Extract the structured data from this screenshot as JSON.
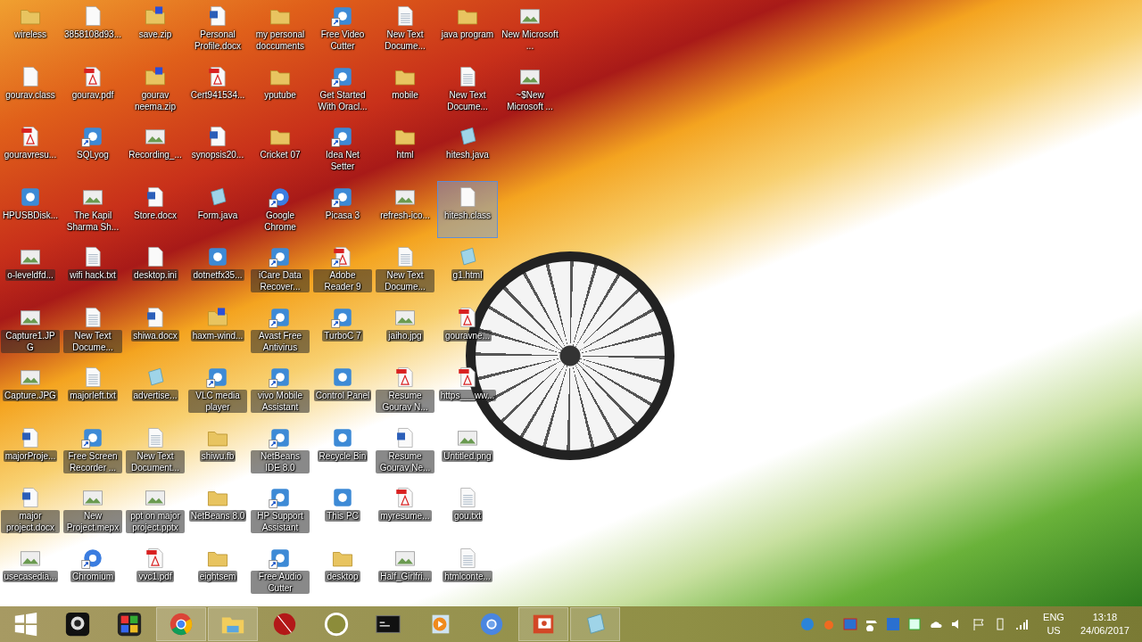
{
  "desktop_icon_rows": [
    [
      {
        "label": "wireless",
        "kind": "folder",
        "shortcut": false,
        "selected": false
      },
      {
        "label": "3858108d93...",
        "kind": "blank",
        "shortcut": false,
        "selected": false
      },
      {
        "label": "save.zip",
        "kind": "zip",
        "shortcut": false,
        "selected": false
      },
      {
        "label": "Personal Profile.docx",
        "kind": "word",
        "shortcut": false,
        "selected": false
      },
      {
        "label": "my personal doccuments",
        "kind": "folder",
        "shortcut": false,
        "selected": false
      },
      {
        "label": "Free Video Cutter",
        "kind": "app",
        "shortcut": true,
        "selected": false
      },
      {
        "label": "New Text Docume...",
        "kind": "text",
        "shortcut": false,
        "selected": false
      },
      {
        "label": "java program",
        "kind": "folder",
        "shortcut": false,
        "selected": false
      },
      {
        "label": "New Microsoft ...",
        "kind": "image",
        "shortcut": false,
        "selected": false
      }
    ],
    [
      {
        "label": "gourav.class",
        "kind": "blank",
        "shortcut": false,
        "selected": false
      },
      {
        "label": "gourav.pdf",
        "kind": "pdf",
        "shortcut": false,
        "selected": false
      },
      {
        "label": "gourav neema.zip",
        "kind": "zip",
        "shortcut": false,
        "selected": false
      },
      {
        "label": "Cert941534...",
        "kind": "pdf",
        "shortcut": false,
        "selected": false
      },
      {
        "label": "yputube",
        "kind": "folder",
        "shortcut": false,
        "selected": false
      },
      {
        "label": "Get Started With Oracl...",
        "kind": "app",
        "shortcut": true,
        "selected": false
      },
      {
        "label": "mobile",
        "kind": "folder",
        "shortcut": false,
        "selected": false
      },
      {
        "label": "New Text Docume...",
        "kind": "text",
        "shortcut": false,
        "selected": false
      },
      {
        "label": "~$New Microsoft ...",
        "kind": "image",
        "shortcut": false,
        "selected": false
      }
    ],
    [
      {
        "label": "gouravresu...",
        "kind": "pdf",
        "shortcut": false,
        "selected": false
      },
      {
        "label": "SQLyog",
        "kind": "app",
        "shortcut": true,
        "selected": false
      },
      {
        "label": "Recording_...",
        "kind": "image",
        "shortcut": false,
        "selected": false
      },
      {
        "label": "synopsis20...",
        "kind": "word",
        "shortcut": false,
        "selected": false
      },
      {
        "label": "Cricket 07",
        "kind": "folder",
        "shortcut": false,
        "selected": false
      },
      {
        "label": "Idea Net Setter",
        "kind": "app",
        "shortcut": true,
        "selected": false
      },
      {
        "label": "html",
        "kind": "folder",
        "shortcut": false,
        "selected": false
      },
      {
        "label": "hitesh.java",
        "kind": "notepad",
        "shortcut": false,
        "selected": false
      }
    ],
    [
      {
        "label": "HPUSBDisk...",
        "kind": "app",
        "shortcut": false,
        "selected": false
      },
      {
        "label": "The Kapil Sharma Sh...",
        "kind": "image",
        "shortcut": false,
        "selected": false
      },
      {
        "label": "Store.docx",
        "kind": "word",
        "shortcut": false,
        "selected": false
      },
      {
        "label": "Form.java",
        "kind": "notepad",
        "shortcut": false,
        "selected": false
      },
      {
        "label": "Google Chrome",
        "kind": "browser",
        "shortcut": true,
        "selected": false
      },
      {
        "label": "Picasa 3",
        "kind": "app",
        "shortcut": true,
        "selected": false
      },
      {
        "label": "refresh-ico...",
        "kind": "image",
        "shortcut": false,
        "selected": false
      },
      {
        "label": "hitesh.class",
        "kind": "blank",
        "shortcut": false,
        "selected": true
      }
    ],
    [
      {
        "label": "o-leveldfd...",
        "kind": "image",
        "shortcut": false,
        "selected": false
      },
      {
        "label": "wifi hack.txt",
        "kind": "text",
        "shortcut": false,
        "selected": false
      },
      {
        "label": "desktop.ini",
        "kind": "blank",
        "shortcut": false,
        "selected": false
      },
      {
        "label": "dotnetfx35...",
        "kind": "app",
        "shortcut": false,
        "selected": false
      },
      {
        "label": "iCare Data Recover...",
        "kind": "app",
        "shortcut": true,
        "selected": false
      },
      {
        "label": "Adobe Reader 9",
        "kind": "pdf",
        "shortcut": true,
        "selected": false
      },
      {
        "label": "New Text Docume...",
        "kind": "text",
        "shortcut": false,
        "selected": false
      },
      {
        "label": "g1.html",
        "kind": "notepad",
        "shortcut": false,
        "selected": false
      }
    ],
    [
      {
        "label": "Capture1.JPG",
        "kind": "image",
        "shortcut": false,
        "selected": false
      },
      {
        "label": "New Text Docume...",
        "kind": "text",
        "shortcut": false,
        "selected": false
      },
      {
        "label": "shiwa.docx",
        "kind": "word",
        "shortcut": false,
        "selected": false
      },
      {
        "label": "haxm-wind...",
        "kind": "zip",
        "shortcut": false,
        "selected": false
      },
      {
        "label": "Avast Free Antivirus",
        "kind": "app",
        "shortcut": true,
        "selected": false
      },
      {
        "label": "TurboC 7",
        "kind": "app",
        "shortcut": true,
        "selected": false
      },
      {
        "label": "jaiho.jpg",
        "kind": "image",
        "shortcut": false,
        "selected": false
      },
      {
        "label": "gouravne...",
        "kind": "pdf",
        "shortcut": false,
        "selected": false
      }
    ],
    [
      {
        "label": "Capture.JPG",
        "kind": "image",
        "shortcut": false,
        "selected": false
      },
      {
        "label": "majorleft.txt",
        "kind": "text",
        "shortcut": false,
        "selected": false
      },
      {
        "label": "advertise...",
        "kind": "notepad",
        "shortcut": false,
        "selected": false
      },
      {
        "label": "VLC media player",
        "kind": "app",
        "shortcut": true,
        "selected": false
      },
      {
        "label": "vivo Mobile Assistant",
        "kind": "app",
        "shortcut": true,
        "selected": false
      },
      {
        "label": "Control Panel",
        "kind": "app",
        "shortcut": false,
        "selected": false
      },
      {
        "label": "Resume Gourav N...",
        "kind": "pdf",
        "shortcut": false,
        "selected": false
      },
      {
        "label": "https___ww...",
        "kind": "pdf",
        "shortcut": false,
        "selected": false
      }
    ],
    [
      {
        "label": "majorProje...",
        "kind": "word",
        "shortcut": false,
        "selected": false
      },
      {
        "label": "Free Screen Recorder ...",
        "kind": "app",
        "shortcut": true,
        "selected": false
      },
      {
        "label": "New Text Document...",
        "kind": "text",
        "shortcut": false,
        "selected": false
      },
      {
        "label": "shiwu.fb",
        "kind": "folder",
        "shortcut": false,
        "selected": false
      },
      {
        "label": "NetBeans IDE 8.0",
        "kind": "app",
        "shortcut": true,
        "selected": false
      },
      {
        "label": "Recycle Bin",
        "kind": "app",
        "shortcut": false,
        "selected": false
      },
      {
        "label": "Resume Gourav Ne...",
        "kind": "word",
        "shortcut": false,
        "selected": false
      },
      {
        "label": "Untitled.png",
        "kind": "image",
        "shortcut": false,
        "selected": false
      }
    ],
    [
      {
        "label": "major project.docx",
        "kind": "word",
        "shortcut": false,
        "selected": false
      },
      {
        "label": "New Project.mepx",
        "kind": "image",
        "shortcut": false,
        "selected": false
      },
      {
        "label": "ppt on major project.pptx",
        "kind": "image",
        "shortcut": false,
        "selected": false
      },
      {
        "label": "NetBeans 8.0",
        "kind": "folder",
        "shortcut": false,
        "selected": false
      },
      {
        "label": "HP Support Assistant",
        "kind": "app",
        "shortcut": true,
        "selected": false
      },
      {
        "label": "This PC",
        "kind": "app",
        "shortcut": false,
        "selected": false
      },
      {
        "label": "myresume...",
        "kind": "pdf",
        "shortcut": false,
        "selected": false
      },
      {
        "label": "gou.txt",
        "kind": "text",
        "shortcut": false,
        "selected": false
      }
    ],
    [
      {
        "label": "usecasedia...",
        "kind": "image",
        "shortcut": false,
        "selected": false
      },
      {
        "label": "Chromium",
        "kind": "browser",
        "shortcut": true,
        "selected": false
      },
      {
        "label": "vvc1.pdf",
        "kind": "pdf",
        "shortcut": false,
        "selected": false
      },
      {
        "label": "eightsem",
        "kind": "folder",
        "shortcut": false,
        "selected": false
      },
      {
        "label": "Free Audio Cutter",
        "kind": "app",
        "shortcut": true,
        "selected": false
      },
      {
        "label": "desktop",
        "kind": "folder",
        "shortcut": false,
        "selected": false
      },
      {
        "label": "Half_Girlfri...",
        "kind": "image",
        "shortcut": false,
        "selected": false
      },
      {
        "label": "htmlconte...",
        "kind": "text",
        "shortcut": false,
        "selected": false
      }
    ]
  ],
  "taskbar": {
    "items": [
      {
        "kind": "start",
        "open": false
      },
      {
        "kind": "webcam",
        "open": false
      },
      {
        "kind": "puzzle",
        "open": false
      },
      {
        "kind": "browser",
        "open": true
      },
      {
        "kind": "explorer",
        "open": true
      },
      {
        "kind": "ball",
        "open": false
      },
      {
        "kind": "logo",
        "open": false
      },
      {
        "kind": "terminal",
        "open": false
      },
      {
        "kind": "media",
        "open": false
      },
      {
        "kind": "chromium",
        "open": false
      },
      {
        "kind": "slides",
        "open": true
      },
      {
        "kind": "notepad",
        "open": true
      }
    ],
    "language": "ENG",
    "region": "US",
    "time": "13:18",
    "date": "24/06/2017"
  }
}
